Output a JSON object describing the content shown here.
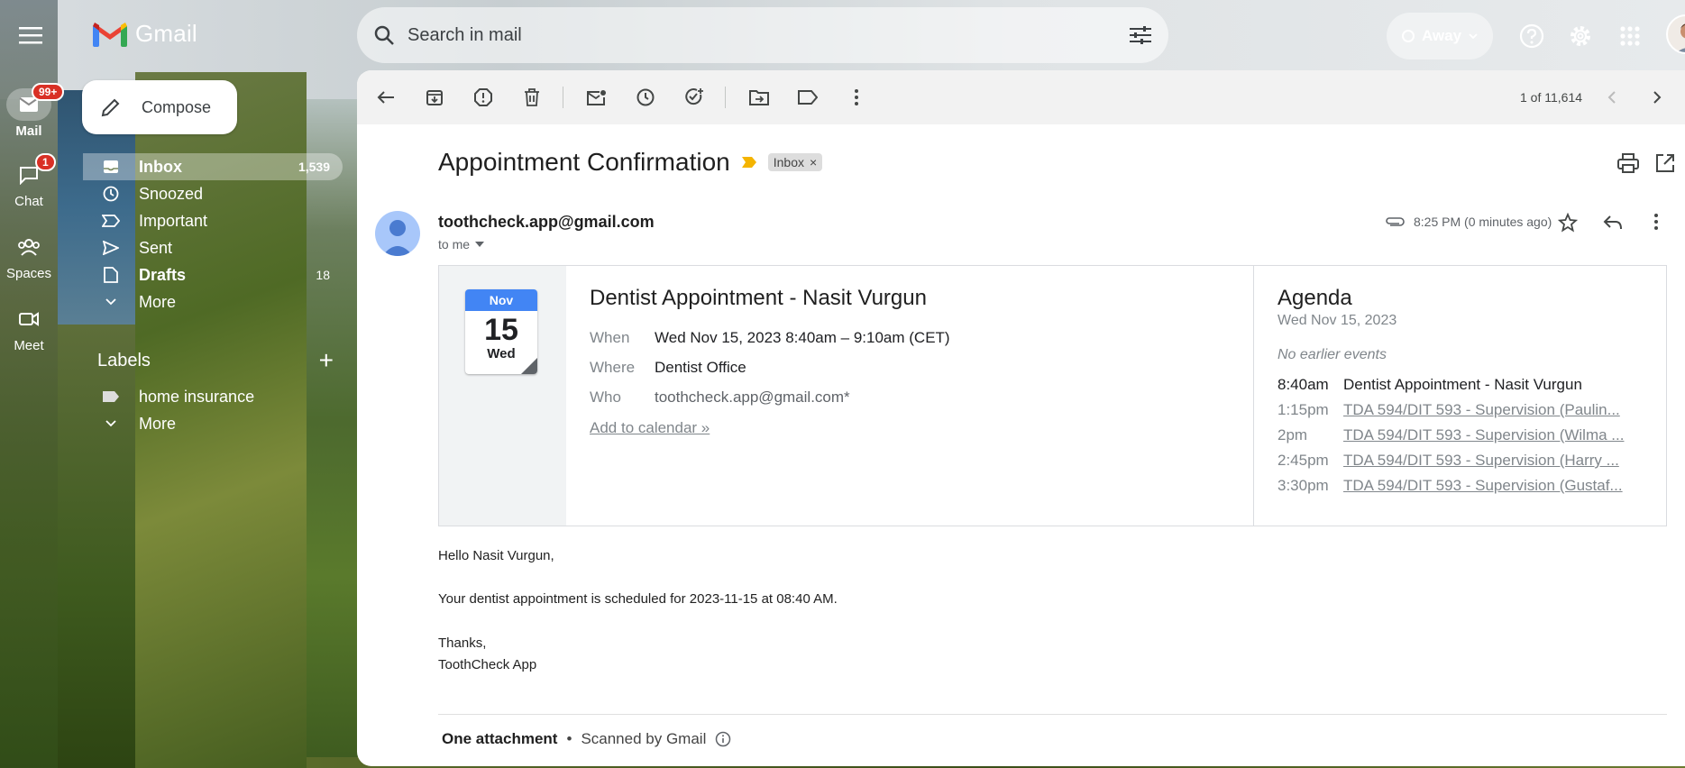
{
  "app": {
    "logo_text": "Gmail"
  },
  "search": {
    "placeholder": "Search in mail"
  },
  "status": {
    "label": "Away"
  },
  "rail": [
    {
      "label": "Mail",
      "badge": "99+"
    },
    {
      "label": "Chat",
      "badge": "1"
    },
    {
      "label": "Spaces"
    },
    {
      "label": "Meet"
    }
  ],
  "sidebar": {
    "compose_label": "Compose",
    "items": [
      {
        "label": "Inbox",
        "count": "1,539"
      },
      {
        "label": "Snoozed"
      },
      {
        "label": "Important"
      },
      {
        "label": "Sent"
      },
      {
        "label": "Drafts",
        "count": "18"
      },
      {
        "label": "More"
      }
    ],
    "labels_heading": "Labels",
    "labels": [
      {
        "label": "home insurance"
      },
      {
        "label": "More"
      }
    ]
  },
  "toolbar": {
    "pager": "1 of 11,614"
  },
  "email": {
    "subject": "Appointment Confirmation",
    "chip": "Inbox",
    "sender": "toothcheck.app@gmail.com",
    "to": "to me",
    "time": "8:25 PM (0 minutes ago)",
    "body": {
      "greeting": "Hello Nasit Vurgun,",
      "line": "Your dentist appointment is scheduled for 2023-11-15 at 08:40 AM.",
      "thanks": "Thanks,",
      "signature": "ToothCheck App"
    },
    "attachment": {
      "label": "One attachment",
      "sep": "•",
      "scanned": "Scanned by Gmail"
    }
  },
  "invite": {
    "calendar": {
      "month": "Nov",
      "day": "15",
      "weekday": "Wed"
    },
    "title": "Dentist Appointment - Nasit Vurgun",
    "when_label": "When",
    "when": "Wed Nov 15, 2023 8:40am – 9:10am (CET)",
    "where_label": "Where",
    "where": "Dentist Office",
    "who_label": "Who",
    "who": "toothcheck.app@gmail.com*",
    "add_link": "Add to calendar »"
  },
  "agenda": {
    "title": "Agenda",
    "date": "Wed Nov 15, 2023",
    "no_earlier": "No earlier events",
    "events": [
      {
        "time": "8:40am",
        "title": "Dentist Appointment - Nasit Vurgun"
      },
      {
        "time": "1:15pm",
        "title": "TDA 594/DIT 593 - Supervision (Paulin..."
      },
      {
        "time": "2pm",
        "title": "TDA 594/DIT 593 - Supervision (Wilma ..."
      },
      {
        "time": "2:45pm",
        "title": "TDA 594/DIT 593 - Supervision (Harry ..."
      },
      {
        "time": "3:30pm",
        "title": "TDA 594/DIT 593 - Supervision (Gustaf..."
      }
    ]
  },
  "colors": {
    "accent": "#4285f4",
    "badge": "#d93025",
    "gmail_red": "#ea4335"
  }
}
